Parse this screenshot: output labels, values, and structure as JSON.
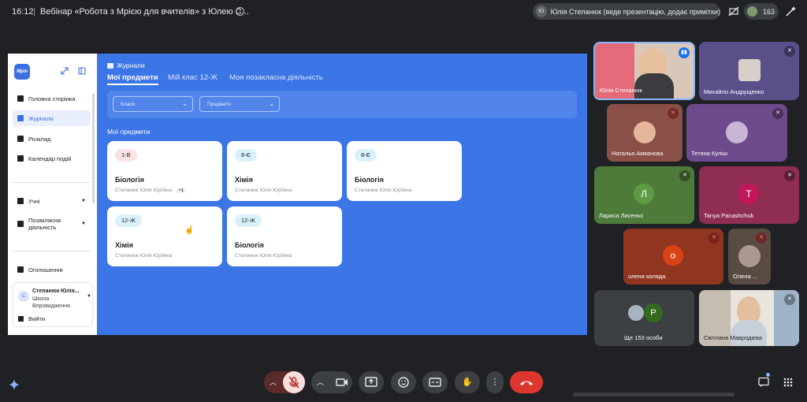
{
  "topbar": {
    "time": "16:12",
    "separator": "|",
    "meeting_title": "Вебінар «Робота з Мрією для вчителів» з Юлею С...",
    "info_icon": "i",
    "presenter_initials": "Ю",
    "presenter_text": "Юлія Степанюк (веде презентацію, додає примітки)",
    "participant_count": "163"
  },
  "app": {
    "logo": "Мрія",
    "nav": [
      {
        "label": "Головна сторінка"
      },
      {
        "label": "Журнали"
      },
      {
        "label": "Розклад"
      },
      {
        "label": "Календар подій"
      }
    ],
    "nav2": [
      {
        "label": "Учні"
      },
      {
        "label": "Позакласна діяльність"
      }
    ],
    "announcements": "Оголошення",
    "user": {
      "initial": "С",
      "name": "Степанюк Юлія...",
      "school": "Школа Впровадження",
      "logout": "Вийти"
    },
    "breadcrumb": "Журнали",
    "tabs": [
      "Мої предмети",
      "Мій клас 12-Ж",
      "Моя позакласна діяльність"
    ],
    "filters": {
      "classes": "Класи",
      "subjects": "Предмети"
    },
    "section_title": "Мої предмети",
    "cards": [
      {
        "badge": "1-В",
        "subject": "Біологія",
        "teacher": "Степанюк Юлія Юріївна",
        "extra": "+1"
      },
      {
        "badge": "8-Є",
        "subject": "Хімія",
        "teacher": "Степанюк Юлія Юріївна",
        "extra": ""
      },
      {
        "badge": "8-Є",
        "subject": "Біологія",
        "teacher": "Степанюк Юлія Юріївна",
        "extra": ""
      },
      {
        "badge": "12-Ж",
        "subject": "Хімія",
        "teacher": "Степанюк Юлія Юріївна",
        "extra": ""
      },
      {
        "badge": "12-Ж",
        "subject": "Біологія",
        "teacher": "Степанюк Юлія Юріївна",
        "extra": ""
      }
    ]
  },
  "participants": [
    {
      "name": "Юлія Степанюк"
    },
    {
      "name": "Михайло Андрущенко"
    },
    {
      "name": "Наталья Акманова"
    },
    {
      "name": "Тетяна Куліш"
    },
    {
      "name": "Лариса Лисенко",
      "initial": "Л"
    },
    {
      "name": "Tanya Panashchuk",
      "initial": "T"
    },
    {
      "name": "олена коляда",
      "initial": "о"
    },
    {
      "name": "Олена ..."
    },
    {
      "name": "Ще 153 особи",
      "initial": "P"
    },
    {
      "name": "Світлана Мавродієва"
    }
  ],
  "colors": {
    "presentation_bg": "#3b75e6",
    "meet_bg": "#202124",
    "end_call": "#dc362e"
  }
}
